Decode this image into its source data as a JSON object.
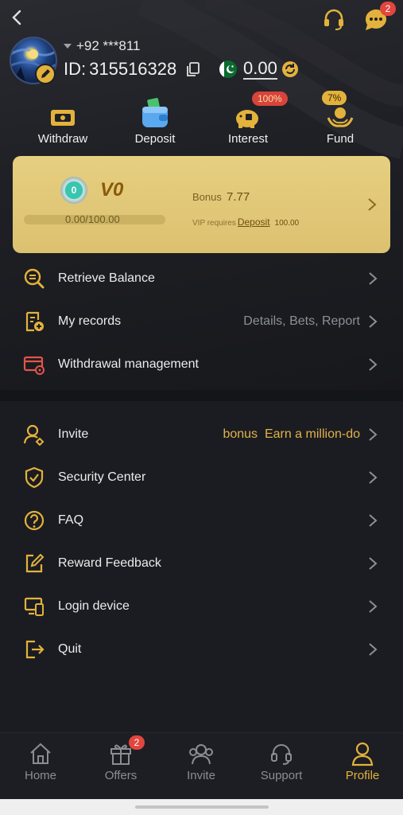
{
  "top_bar": {
    "back_icon": "chevron-left-icon",
    "headset_icon": "headset-icon",
    "chat_icon": "chat-bubble-icon",
    "chat_badge": "2"
  },
  "profile": {
    "phone": "+92 ***811",
    "id_label": "ID:",
    "id_value": "315516328",
    "balance": "0.00"
  },
  "quick_actions": [
    {
      "label": "Withdraw",
      "icon": "withdraw-icon"
    },
    {
      "label": "Deposit",
      "icon": "wallet-icon"
    },
    {
      "label": "Interest",
      "icon": "piggy-bank-icon",
      "badge": "100%"
    },
    {
      "label": "Fund",
      "icon": "hand-coin-icon",
      "badge": "7%"
    }
  ],
  "vip": {
    "medal_level": "0",
    "level": "V0",
    "progress_text": "0.00/100.00",
    "progress_fraction": 0.0,
    "bonus_label": "Bonus",
    "bonus_value": "7.77",
    "requires_text": "VIP requires",
    "requires_link": "Deposit",
    "requires_amount": "100.00"
  },
  "menu_group_1": [
    {
      "label": "Retrieve Balance",
      "icon": "search-coin-icon"
    },
    {
      "label": "My records",
      "icon": "records-icon",
      "sub": "Details, Bets, Report"
    },
    {
      "label": "Withdrawal management",
      "icon": "card-gear-icon"
    }
  ],
  "menu_group_2": [
    {
      "label": "Invite",
      "icon": "invite-user-icon",
      "sub": "bonus  Earn a million-do"
    },
    {
      "label": "Security Center",
      "icon": "shield-icon"
    },
    {
      "label": "FAQ",
      "icon": "question-icon"
    },
    {
      "label": "Reward Feedback",
      "icon": "edit-icon"
    },
    {
      "label": "Login device",
      "icon": "devices-icon"
    },
    {
      "label": "Quit",
      "icon": "logout-icon"
    }
  ],
  "bottom_nav": [
    {
      "label": "Home",
      "icon": "home-icon"
    },
    {
      "label": "Offers",
      "icon": "gift-icon",
      "badge": "2"
    },
    {
      "label": "Invite",
      "icon": "users-icon"
    },
    {
      "label": "Support",
      "icon": "headset-icon"
    },
    {
      "label": "Profile",
      "icon": "user-icon",
      "active": true
    }
  ],
  "colors": {
    "accent": "#e3b23c",
    "background": "#1b1c21",
    "vip_card": "#e0c674",
    "badge_red": "#e2463f"
  }
}
